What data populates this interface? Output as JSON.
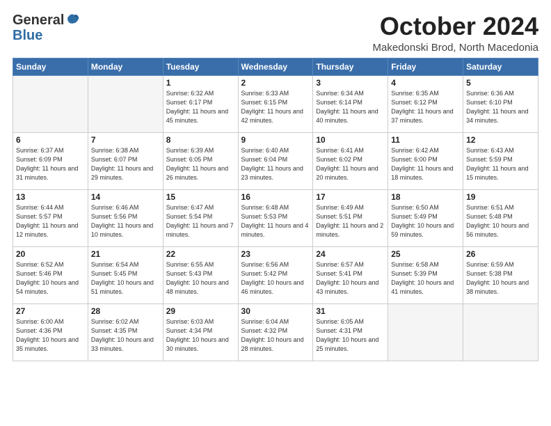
{
  "header": {
    "logo_general": "General",
    "logo_blue": "Blue",
    "month_title": "October 2024",
    "location": "Makedonski Brod, North Macedonia"
  },
  "weekdays": [
    "Sunday",
    "Monday",
    "Tuesday",
    "Wednesday",
    "Thursday",
    "Friday",
    "Saturday"
  ],
  "weeks": [
    [
      {
        "day": "",
        "info": ""
      },
      {
        "day": "",
        "info": ""
      },
      {
        "day": "1",
        "info": "Sunrise: 6:32 AM\nSunset: 6:17 PM\nDaylight: 11 hours and 45 minutes."
      },
      {
        "day": "2",
        "info": "Sunrise: 6:33 AM\nSunset: 6:15 PM\nDaylight: 11 hours and 42 minutes."
      },
      {
        "day": "3",
        "info": "Sunrise: 6:34 AM\nSunset: 6:14 PM\nDaylight: 11 hours and 40 minutes."
      },
      {
        "day": "4",
        "info": "Sunrise: 6:35 AM\nSunset: 6:12 PM\nDaylight: 11 hours and 37 minutes."
      },
      {
        "day": "5",
        "info": "Sunrise: 6:36 AM\nSunset: 6:10 PM\nDaylight: 11 hours and 34 minutes."
      }
    ],
    [
      {
        "day": "6",
        "info": "Sunrise: 6:37 AM\nSunset: 6:09 PM\nDaylight: 11 hours and 31 minutes."
      },
      {
        "day": "7",
        "info": "Sunrise: 6:38 AM\nSunset: 6:07 PM\nDaylight: 11 hours and 29 minutes."
      },
      {
        "day": "8",
        "info": "Sunrise: 6:39 AM\nSunset: 6:05 PM\nDaylight: 11 hours and 26 minutes."
      },
      {
        "day": "9",
        "info": "Sunrise: 6:40 AM\nSunset: 6:04 PM\nDaylight: 11 hours and 23 minutes."
      },
      {
        "day": "10",
        "info": "Sunrise: 6:41 AM\nSunset: 6:02 PM\nDaylight: 11 hours and 20 minutes."
      },
      {
        "day": "11",
        "info": "Sunrise: 6:42 AM\nSunset: 6:00 PM\nDaylight: 11 hours and 18 minutes."
      },
      {
        "day": "12",
        "info": "Sunrise: 6:43 AM\nSunset: 5:59 PM\nDaylight: 11 hours and 15 minutes."
      }
    ],
    [
      {
        "day": "13",
        "info": "Sunrise: 6:44 AM\nSunset: 5:57 PM\nDaylight: 11 hours and 12 minutes."
      },
      {
        "day": "14",
        "info": "Sunrise: 6:46 AM\nSunset: 5:56 PM\nDaylight: 11 hours and 10 minutes."
      },
      {
        "day": "15",
        "info": "Sunrise: 6:47 AM\nSunset: 5:54 PM\nDaylight: 11 hours and 7 minutes."
      },
      {
        "day": "16",
        "info": "Sunrise: 6:48 AM\nSunset: 5:53 PM\nDaylight: 11 hours and 4 minutes."
      },
      {
        "day": "17",
        "info": "Sunrise: 6:49 AM\nSunset: 5:51 PM\nDaylight: 11 hours and 2 minutes."
      },
      {
        "day": "18",
        "info": "Sunrise: 6:50 AM\nSunset: 5:49 PM\nDaylight: 10 hours and 59 minutes."
      },
      {
        "day": "19",
        "info": "Sunrise: 6:51 AM\nSunset: 5:48 PM\nDaylight: 10 hours and 56 minutes."
      }
    ],
    [
      {
        "day": "20",
        "info": "Sunrise: 6:52 AM\nSunset: 5:46 PM\nDaylight: 10 hours and 54 minutes."
      },
      {
        "day": "21",
        "info": "Sunrise: 6:54 AM\nSunset: 5:45 PM\nDaylight: 10 hours and 51 minutes."
      },
      {
        "day": "22",
        "info": "Sunrise: 6:55 AM\nSunset: 5:43 PM\nDaylight: 10 hours and 48 minutes."
      },
      {
        "day": "23",
        "info": "Sunrise: 6:56 AM\nSunset: 5:42 PM\nDaylight: 10 hours and 46 minutes."
      },
      {
        "day": "24",
        "info": "Sunrise: 6:57 AM\nSunset: 5:41 PM\nDaylight: 10 hours and 43 minutes."
      },
      {
        "day": "25",
        "info": "Sunrise: 6:58 AM\nSunset: 5:39 PM\nDaylight: 10 hours and 41 minutes."
      },
      {
        "day": "26",
        "info": "Sunrise: 6:59 AM\nSunset: 5:38 PM\nDaylight: 10 hours and 38 minutes."
      }
    ],
    [
      {
        "day": "27",
        "info": "Sunrise: 6:00 AM\nSunset: 4:36 PM\nDaylight: 10 hours and 35 minutes."
      },
      {
        "day": "28",
        "info": "Sunrise: 6:02 AM\nSunset: 4:35 PM\nDaylight: 10 hours and 33 minutes."
      },
      {
        "day": "29",
        "info": "Sunrise: 6:03 AM\nSunset: 4:34 PM\nDaylight: 10 hours and 30 minutes."
      },
      {
        "day": "30",
        "info": "Sunrise: 6:04 AM\nSunset: 4:32 PM\nDaylight: 10 hours and 28 minutes."
      },
      {
        "day": "31",
        "info": "Sunrise: 6:05 AM\nSunset: 4:31 PM\nDaylight: 10 hours and 25 minutes."
      },
      {
        "day": "",
        "info": ""
      },
      {
        "day": "",
        "info": ""
      }
    ]
  ]
}
